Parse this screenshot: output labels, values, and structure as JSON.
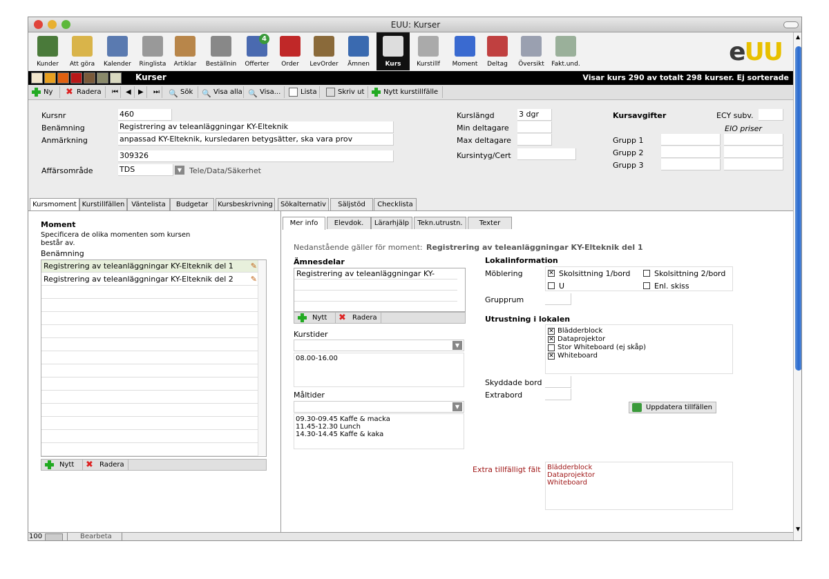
{
  "window": {
    "title": "EUU: Kurser"
  },
  "toolbar": {
    "items": [
      {
        "label": "Kunder",
        "icon": "customers-icon",
        "color": "#4a7a3a"
      },
      {
        "label": "Att göra",
        "icon": "todo-icon",
        "color": "#d9b44a"
      },
      {
        "label": "Kalender",
        "icon": "calendar-icon",
        "color": "#5a7ab0"
      },
      {
        "label": "Ringlista",
        "icon": "phone-icon",
        "color": "#999999"
      },
      {
        "label": "Artiklar",
        "icon": "box-icon",
        "color": "#b8864a"
      },
      {
        "label": "Beställnin",
        "icon": "fax-icon",
        "color": "#888888"
      },
      {
        "label": "Offerter",
        "icon": "offer-icon",
        "color": "#4a6ab0"
      },
      {
        "label": "Order",
        "icon": "book-icon",
        "color": "#c02828"
      },
      {
        "label": "LevOrder",
        "icon": "delivery-icon",
        "color": "#8a6a3a"
      },
      {
        "label": "Ämnen",
        "icon": "blueprint-icon",
        "color": "#3a6ab0"
      },
      {
        "label": "Kurs",
        "icon": "easel-icon",
        "color": "#dddddd"
      },
      {
        "label": "Kurstillf",
        "icon": "stopwatch-icon",
        "color": "#aaaaaa"
      },
      {
        "label": "Moment",
        "icon": "puzzle-icon",
        "color": "#3a6ad0"
      },
      {
        "label": "Deltag",
        "icon": "participants-icon",
        "color": "#c04040"
      },
      {
        "label": "Översikt",
        "icon": "overview-icon",
        "color": "#9aa0b0"
      },
      {
        "label": "Fakt.und.",
        "icon": "invoice-icon",
        "color": "#9ab09a"
      }
    ],
    "badge": "4",
    "logo": "eUU"
  },
  "header": {
    "title": "Kurser",
    "status": "Visar kurs 290 av totalt 298 kurser. Ej sorterade",
    "swatches": [
      "#f2e6cc",
      "#e8a020",
      "#e06010",
      "#b81818",
      "#7a5a3a",
      "#8a8a6a",
      "#d8d8c0"
    ]
  },
  "actions": {
    "new": "Ny",
    "delete": "Radera",
    "search": "Sök",
    "show_all": "Visa alla",
    "show": "Visa...",
    "list": "Lista",
    "print": "Skriv ut",
    "new_occasion": "Nytt kurstillfälle"
  },
  "form": {
    "kursnr_label": "Kursnr",
    "kursnr": "460",
    "benamning_label": "Benämning",
    "benamning": "Registrering av teleanläggningar KY-Elteknik",
    "anmarkning_label": "Anmärkning",
    "anmarkning": "anpassad KY-Elteknik, kursledaren betygsätter, ska vara prov",
    "extra": "309326",
    "affar_label": "Affärsområde",
    "affar": "TDS",
    "affar_desc": "Tele/Data/Säkerhet",
    "kurslangd_label": "Kurslängd",
    "kurslangd": "3 dgr",
    "min_label": "Min deltagare",
    "max_label": "Max deltagare",
    "intyg_label": "Kursintyg/Cert",
    "avgift_title": "Kursavgifter",
    "ecy_label": "ECY subv.",
    "eio_label": "EIO priser",
    "grupp": [
      "Grupp 1",
      "Grupp 2",
      "Grupp 3"
    ]
  },
  "tabs": [
    "Kursmoment",
    "Kurstillfällen",
    "Väntelista",
    "Budgetar",
    "Kursbeskrivning",
    "Sökalternativ",
    "Säljstöd",
    "Checklista"
  ],
  "moment": {
    "title": "Moment",
    "desc1": "Specificera de olika momenten som kursen",
    "desc2": "består av.",
    "col": "Benämning",
    "rows": [
      "Registrering av teleanläggningar KY-Elteknik del 1",
      "Registrering av teleanläggningar KY-Elteknik del 2"
    ],
    "new": "Nytt",
    "delete": "Radera"
  },
  "subtabs": [
    "Mer info",
    "Elevdok.",
    "Lärarhjälp",
    "Tekn.utrustn.",
    "Texter"
  ],
  "info": {
    "intro": "Nedanstående gäller för moment:",
    "moment_name": "Registrering av teleanläggningar KY-Elteknik del 1",
    "amnes_title": "Ämnesdelar",
    "amnes_rows": [
      "Registrering av teleanläggningar KY-"
    ],
    "new": "Nytt",
    "delete": "Radera",
    "kurstider_title": "Kurstider",
    "kurstider": "08.00-16.00",
    "maltider_title": "Måltider",
    "maltider": [
      "09.30-09.45 Kaffe & macka",
      "11.45-12.30 Lunch",
      "14.30-14.45 Kaffe & kaka"
    ],
    "lokal_title": "Lokalinformation",
    "mobl_label": "Möblering",
    "mobl": [
      {
        "label": "Skolsittning 1/bord",
        "checked": true
      },
      {
        "label": "Skolsittning 2/bord",
        "checked": false
      },
      {
        "label": "U",
        "checked": false
      },
      {
        "label": "Enl. skiss",
        "checked": false
      }
    ],
    "grupprum_label": "Grupprum",
    "utr_title": "Utrustning i lokalen",
    "utr": [
      {
        "label": "Blädderblock",
        "checked": true
      },
      {
        "label": "Dataprojektor",
        "checked": true
      },
      {
        "label": "Stor Whiteboard (ej skåp)",
        "checked": false
      },
      {
        "label": "Whiteboard",
        "checked": true
      }
    ],
    "skydd_label": "Skyddade bord",
    "extrabord_label": "Extrabord",
    "update_btn": "Uppdatera tillfällen",
    "extra_label": "Extra tillfälligt fält",
    "extra_vals": [
      "Blädderblock",
      "Dataprojektor",
      "Whiteboard"
    ]
  },
  "status": {
    "zoom": "100",
    "mode": "Bearbeta"
  }
}
